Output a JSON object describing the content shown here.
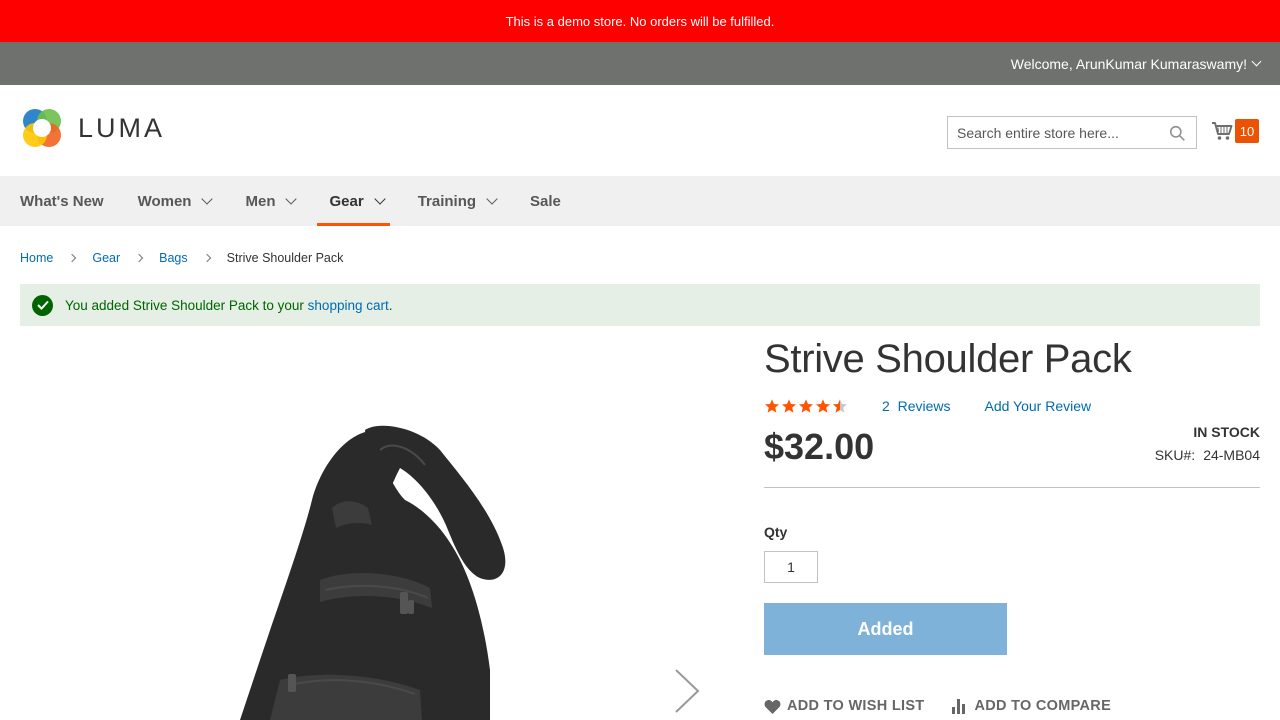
{
  "demo_notice": "This is a demo store. No orders will be fulfilled.",
  "header": {
    "welcome": "Welcome, ArunKumar Kumaraswamy!",
    "logo_text": "LUMA",
    "search_placeholder": "Search entire store here...",
    "cart_count": "10"
  },
  "nav": {
    "items": [
      {
        "label": "What's New",
        "has_submenu": false
      },
      {
        "label": "Women",
        "has_submenu": true
      },
      {
        "label": "Men",
        "has_submenu": true
      },
      {
        "label": "Gear",
        "has_submenu": true,
        "active": true
      },
      {
        "label": "Training",
        "has_submenu": true
      },
      {
        "label": "Sale",
        "has_submenu": false
      }
    ]
  },
  "breadcrumbs": [
    "Home",
    "Gear",
    "Bags",
    "Strive Shoulder Pack"
  ],
  "message": {
    "text_before": "You added Strive Shoulder Pack to your ",
    "link": "shopping cart",
    "text_after": "."
  },
  "product": {
    "title": "Strive Shoulder Pack",
    "rating": 4.5,
    "rating_max": 5,
    "reviews_count": "2",
    "reviews_label": "Reviews",
    "add_review": "Add Your Review",
    "price": "$32.00",
    "stock": "IN STOCK",
    "sku_label": "SKU#:",
    "sku": "24-MB04",
    "qty_label": "Qty",
    "qty_value": "1",
    "add_button": "Added",
    "wishlist": "ADD TO WISH LIST",
    "compare": "ADD TO COMPARE"
  },
  "colors": {
    "demo_bar": "#ff0000",
    "accent": "#ff5501",
    "link": "#006bb4",
    "button": "#7fb2d8",
    "success_bg": "#e5efe5"
  }
}
